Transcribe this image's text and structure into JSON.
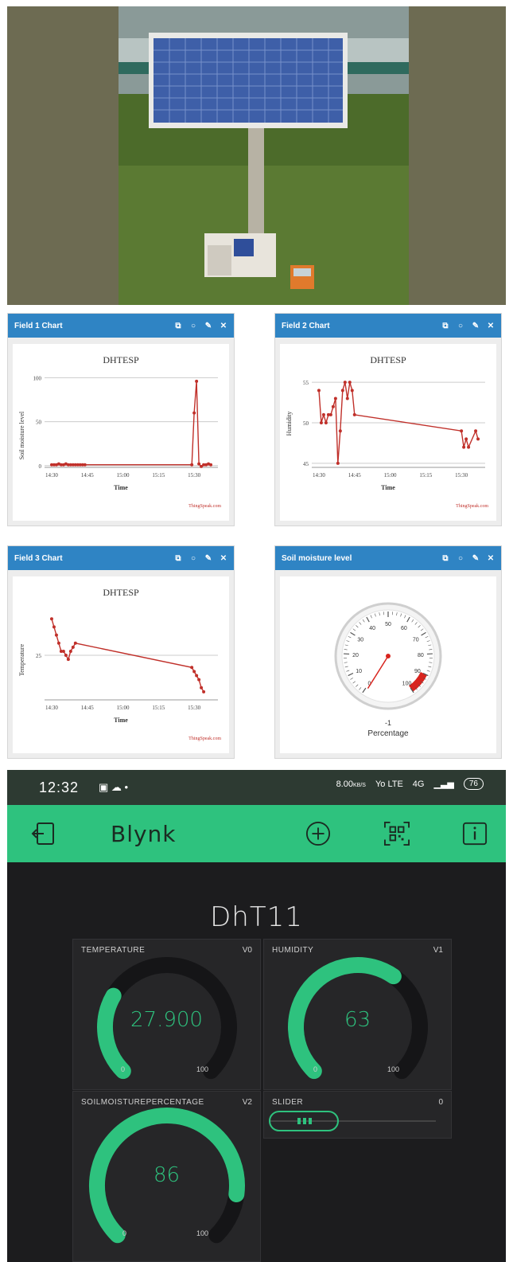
{
  "photo": {
    "subject": "solar-panel-sensor-station"
  },
  "thingspeak": {
    "panels": [
      {
        "title": "Field 1 Chart",
        "chart_title": "DHTESP",
        "xlabel": "Time",
        "ylabel": "Soil moisture level",
        "watermark": "ThingSpeak.com",
        "ticks_x": [
          "14:30",
          "14:45",
          "15:00",
          "15:15",
          "15:30"
        ],
        "ticks_y": [
          "100",
          "50",
          "0"
        ]
      },
      {
        "title": "Field 2 Chart",
        "chart_title": "DHTESP",
        "xlabel": "Time",
        "ylabel": "Humidity",
        "watermark": "ThingSpeak.com",
        "ticks_x": [
          "14:30",
          "14:45",
          "15:00",
          "15:15",
          "15:30"
        ],
        "ticks_y": [
          "55",
          "50",
          "45"
        ]
      },
      {
        "title": "Field 3 Chart",
        "chart_title": "DHTESP",
        "xlabel": "Time",
        "ylabel": "Temperature",
        "watermark": "ThingSpeak.com",
        "ticks_x": [
          "14:30",
          "14:45",
          "15:00",
          "15:15",
          "15:30"
        ],
        "ticks_y": [
          "25"
        ]
      },
      {
        "title": "Soil moisture level",
        "gauge_value": "-1",
        "gauge_unit": "Percentage",
        "gauge_ticks": [
          "0",
          "10",
          "20",
          "30",
          "40",
          "50",
          "60",
          "70",
          "80",
          "90",
          "100"
        ]
      }
    ]
  },
  "chart_data": [
    {
      "type": "line",
      "title": "DHTESP",
      "xlabel": "Time",
      "ylabel": "Soil moisture level",
      "ylim": [
        0,
        100
      ],
      "series": [
        {
          "color": "#c0302a",
          "x": [
            "14:30",
            "14:31",
            "14:32",
            "14:33",
            "14:34",
            "14:35",
            "14:36",
            "14:37",
            "14:38",
            "14:39",
            "14:40",
            "14:41",
            "14:42",
            "14:43",
            "14:44",
            "15:29",
            "15:30",
            "15:31",
            "15:32",
            "15:33",
            "15:34",
            "15:35",
            "15:36",
            "15:37"
          ],
          "y": [
            1,
            1,
            1,
            2,
            1,
            1,
            2,
            1,
            1,
            1,
            1,
            1,
            1,
            1,
            1,
            1,
            60,
            96,
            2,
            -1,
            1,
            1,
            2,
            1
          ]
        }
      ]
    },
    {
      "type": "line",
      "title": "DHTESP",
      "xlabel": "Time",
      "ylabel": "Humidity",
      "ylim": [
        45,
        55
      ],
      "series": [
        {
          "color": "#c0302a",
          "x": [
            "14:30",
            "14:31",
            "14:32",
            "14:33",
            "14:34",
            "14:35",
            "14:36",
            "14:37",
            "14:38",
            "14:39",
            "14:40",
            "14:41",
            "14:42",
            "14:43",
            "14:44",
            "14:45",
            "15:30",
            "15:31",
            "15:32",
            "15:33",
            "15:36",
            "15:37"
          ],
          "y": [
            54,
            50,
            51,
            50,
            51,
            51,
            52,
            53,
            45,
            49,
            54,
            55,
            53,
            55,
            54,
            51,
            49,
            47,
            48,
            47,
            49,
            48
          ]
        }
      ]
    },
    {
      "type": "line",
      "title": "DHTESP",
      "xlabel": "Time",
      "ylabel": "Temperature",
      "series": [
        {
          "color": "#c0302a",
          "x": [
            "14:30",
            "14:31",
            "14:32",
            "14:33",
            "14:34",
            "14:35",
            "14:36",
            "14:37",
            "14:38",
            "14:39",
            "14:40",
            "15:29",
            "15:30",
            "15:31",
            "15:32",
            "15:33",
            "15:34"
          ],
          "y": [
            29.5,
            28.5,
            27.5,
            26.5,
            25.5,
            25.5,
            25,
            24.5,
            25.5,
            26,
            26.5,
            23.5,
            23,
            22.5,
            22,
            21,
            20.5
          ]
        }
      ]
    }
  ],
  "status_bar": {
    "time": "12:32",
    "net_speed": "8.00",
    "net_unit": "KB/S",
    "volte": "Yo LTE",
    "signal": "4G",
    "battery": "76"
  },
  "app": {
    "title": "Blynk",
    "project_title": "DhT11"
  },
  "widgets": {
    "temperature": {
      "label": "TEMPERATURE",
      "pin": "V0",
      "value": "27.900",
      "min": "0",
      "max": "100",
      "fraction": 0.279
    },
    "humidity": {
      "label": "HUMIDITY",
      "pin": "V1",
      "value": "63",
      "min": "0",
      "max": "100",
      "fraction": 0.63
    },
    "soil": {
      "label": "SOILMOISTUREPERCENTAGE",
      "pin": "V2",
      "value": "86",
      "min": "0",
      "max": "100",
      "fraction": 0.86
    },
    "slider": {
      "label": "SLIDER",
      "value": "0"
    }
  },
  "colors": {
    "accent": "#2ec27e",
    "ts_header": "#2f84c4",
    "ts_line": "#c0302a"
  }
}
